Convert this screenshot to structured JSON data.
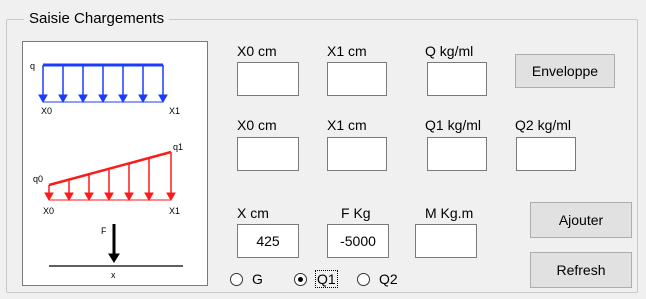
{
  "group": {
    "title": "Saisie Chargements"
  },
  "diagram": {
    "uniform": {
      "load_label": "q",
      "start_label": "X0",
      "end_label": "X1"
    },
    "trapezoid": {
      "start_load_label": "q0",
      "end_load_label": "q1",
      "start_label": "X0",
      "end_label": "X1"
    },
    "point": {
      "force_label": "F",
      "pos_label": "x"
    },
    "colors": {
      "uniform": "#1a3cff",
      "trapezoid": "#ff1a1a",
      "point": "#000000"
    }
  },
  "row1": {
    "x0_label": "X0 cm",
    "x1_label": "X1 cm",
    "q_label": "Q kg/ml",
    "x0_value": "",
    "x1_value": "",
    "q_value": ""
  },
  "row2": {
    "x0_label": "X0 cm",
    "x1_label": "X1 cm",
    "q1_label": "Q1 kg/ml",
    "q2_label": "Q2 kg/ml",
    "x0_value": "",
    "x1_value": "",
    "q1_value": "",
    "q2_value": ""
  },
  "row3": {
    "x_label": "X cm",
    "f_label": "F Kg",
    "m_label": "M Kg.m",
    "x_value": "425",
    "f_value": "-5000",
    "m_value": ""
  },
  "buttons": {
    "enveloppe": "Enveloppe",
    "ajouter": "Ajouter",
    "refresh": "Refresh"
  },
  "radios": {
    "g": "G",
    "q1": "Q1",
    "q2": "Q2",
    "selected": "Q1"
  }
}
